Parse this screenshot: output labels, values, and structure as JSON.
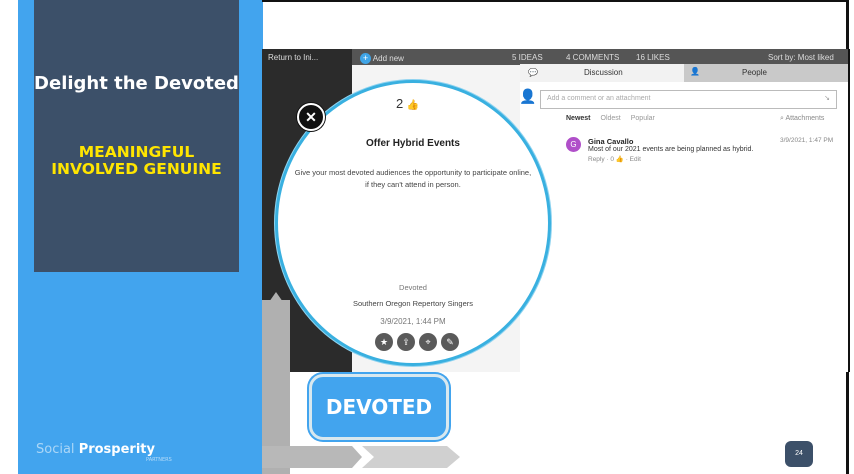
{
  "slide": {
    "title": "Delight the Devoted",
    "keywords": "MEANINGFUL INVOLVED GENUINE",
    "brand_light": "Social",
    "brand_bold": "Prosperity",
    "brand_sub": "PARTNERS",
    "diagram_label": "DEVOTED",
    "page_number": "24"
  },
  "app": {
    "return_label": "Return to Ini...",
    "add_new": "Add new",
    "ideas": "5 IDEAS",
    "comments": "4 COMMENTS",
    "likes": "16 LIKES",
    "sort": "Sort by: Most liked"
  },
  "panel": {
    "tabs": [
      "Discussion",
      "People"
    ],
    "comment_placeholder": "Add a comment or an attachment",
    "sort_options": [
      "Newest",
      "Oldest",
      "Popular"
    ],
    "attachments": "Attachments",
    "comment": {
      "avatar_letter": "G",
      "author": "Gina Cavallo",
      "date": "3/9/2021, 1:47 PM",
      "text": "Most of our 2021 events are being planned as hybrid.",
      "actions": "Reply  ·  0 👍  ·  Edit"
    }
  },
  "idea": {
    "likes": "2",
    "title": "Offer Hybrid Events",
    "body": "Give your most devoted audiences the opportunity to participate online, if they can't attend in person.",
    "category": "Devoted",
    "organization": "Southern Oregon Repertory Singers",
    "date": "3/9/2021, 1:44 PM"
  },
  "icons": [
    "close-icon",
    "thumbs-up-icon",
    "comment-icon",
    "person-icon",
    "star-icon",
    "share-icon",
    "tag-icon",
    "edit-icon"
  ],
  "colors": {
    "accent_blue": "#42a4ee",
    "navy": "#3c5069",
    "keyword_yellow": "#ffe500",
    "avatar_purple": "#b04fc9"
  }
}
